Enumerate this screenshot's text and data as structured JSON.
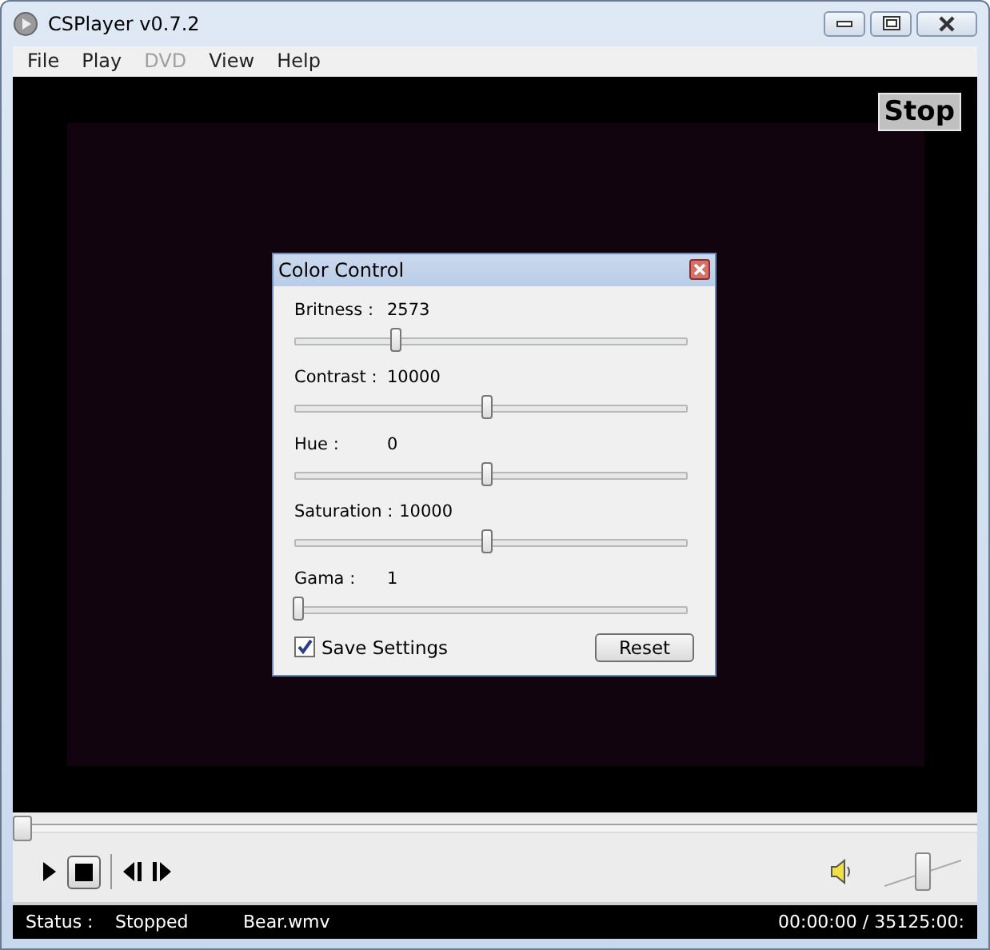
{
  "window": {
    "title": "CSPlayer v0.7.2"
  },
  "menu": [
    {
      "label": "File",
      "disabled": false
    },
    {
      "label": "Play",
      "disabled": false
    },
    {
      "label": "DVD",
      "disabled": true
    },
    {
      "label": "View",
      "disabled": false
    },
    {
      "label": "Help",
      "disabled": false
    }
  ],
  "overlay_button": "Stop",
  "color_control": {
    "title": "Color Control",
    "sliders": [
      {
        "label": "Britness :",
        "value": "2573",
        "level": 0.26
      },
      {
        "label": "Contrast :",
        "value": "10000",
        "level": 0.5
      },
      {
        "label": "Hue :",
        "value": "0",
        "level": 0.5
      },
      {
        "label": "Saturation :",
        "value": "10000",
        "level": 0.5
      },
      {
        "label": "Gama :",
        "value": "1",
        "level": 0
      }
    ],
    "save_settings": {
      "label": "Save Settings",
      "checked": true
    },
    "reset": "Reset"
  },
  "seek": {
    "level": 0
  },
  "volume": {
    "level": 0.5
  },
  "status_bar": {
    "label": "Status :",
    "state": "Stopped",
    "file": "Bear.wmv",
    "time": "00:00:00 / 35125:00:"
  }
}
